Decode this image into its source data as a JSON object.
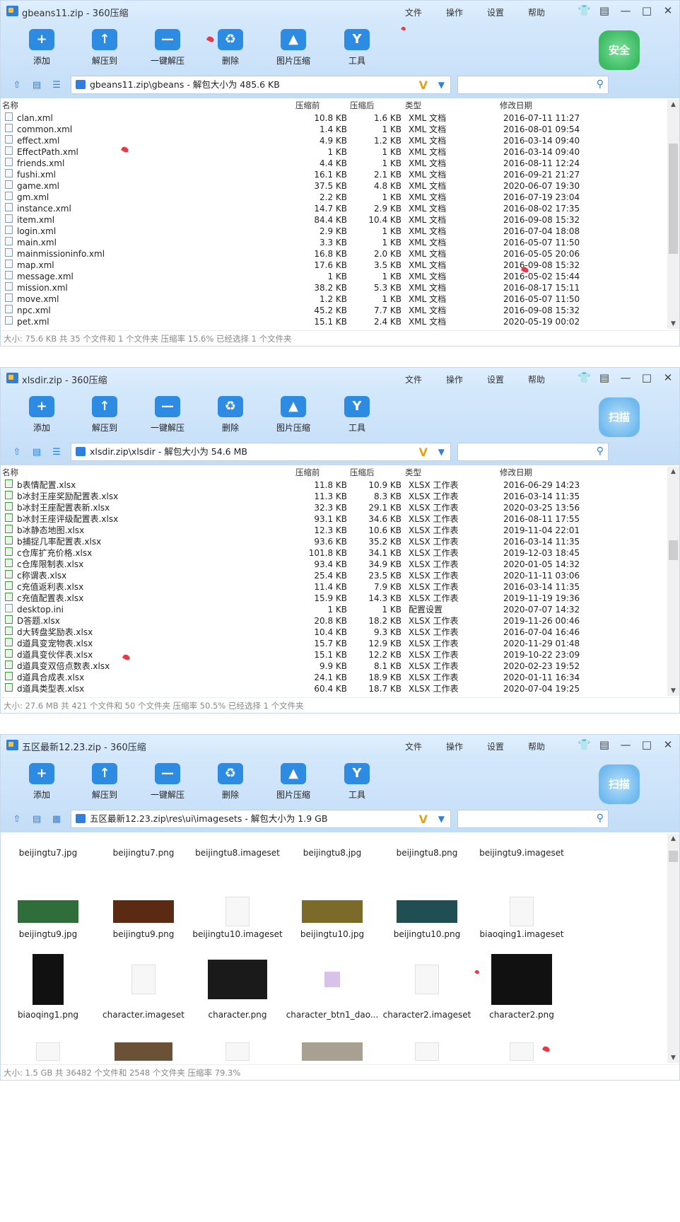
{
  "windows": [
    {
      "title": "gbeans11.zip - 360压缩",
      "menu": [
        "文件",
        "操作",
        "设置",
        "帮助"
      ],
      "tools": [
        "添加",
        "解压到",
        "一键解压",
        "删除",
        "图片压缩",
        "工具"
      ],
      "badge": "安全",
      "path": "gbeans11.zip\\gbeans - 解包大小为 485.6 KB",
      "columns": [
        "名称",
        "压缩前",
        "压缩后",
        "类型",
        "修改日期"
      ],
      "rows": [
        [
          "clan.xml",
          "10.8 KB",
          "1.6 KB",
          "XML 文档",
          "2016-07-11 11:27"
        ],
        [
          "common.xml",
          "1.4 KB",
          "1 KB",
          "XML 文档",
          "2016-08-01 09:54"
        ],
        [
          "effect.xml",
          "4.9 KB",
          "1.2 KB",
          "XML 文档",
          "2016-03-14 09:40"
        ],
        [
          "EffectPath.xml",
          "1 KB",
          "1 KB",
          "XML 文档",
          "2016-03-14 09:40"
        ],
        [
          "friends.xml",
          "4.4 KB",
          "1 KB",
          "XML 文档",
          "2016-08-11 12:24"
        ],
        [
          "fushi.xml",
          "16.1 KB",
          "2.1 KB",
          "XML 文档",
          "2016-09-21 21:27"
        ],
        [
          "game.xml",
          "37.5 KB",
          "4.8 KB",
          "XML 文档",
          "2020-06-07 19:30"
        ],
        [
          "gm.xml",
          "2.2 KB",
          "1 KB",
          "XML 文档",
          "2016-07-19 23:04"
        ],
        [
          "instance.xml",
          "14.7 KB",
          "2.9 KB",
          "XML 文档",
          "2016-08-02 17:35"
        ],
        [
          "item.xml",
          "84.4 KB",
          "10.4 KB",
          "XML 文档",
          "2016-09-08 15:32"
        ],
        [
          "login.xml",
          "2.9 KB",
          "1 KB",
          "XML 文档",
          "2016-07-04 18:08"
        ],
        [
          "main.xml",
          "3.3 KB",
          "1 KB",
          "XML 文档",
          "2016-05-07 11:50"
        ],
        [
          "mainmissioninfo.xml",
          "16.8 KB",
          "2.0 KB",
          "XML 文档",
          "2016-05-05 20:06"
        ],
        [
          "map.xml",
          "17.6 KB",
          "3.5 KB",
          "XML 文档",
          "2016-09-08 15:32"
        ],
        [
          "message.xml",
          "1 KB",
          "1 KB",
          "XML 文档",
          "2016-05-02 15:44"
        ],
        [
          "mission.xml",
          "38.2 KB",
          "5.3 KB",
          "XML 文档",
          "2016-08-17 15:11"
        ],
        [
          "move.xml",
          "1.2 KB",
          "1 KB",
          "XML 文档",
          "2016-05-07 11:50"
        ],
        [
          "npc.xml",
          "45.2 KB",
          "7.7 KB",
          "XML 文档",
          "2016-09-08 15:32"
        ],
        [
          "pet.xml",
          "15.1 KB",
          "2.4 KB",
          "XML 文档",
          "2020-05-19 00:02"
        ]
      ],
      "status": "大小: 75.6 KB 共 35 个文件和 1 个文件夹 压缩率 15.6% 已经选择 1 个文件夹"
    },
    {
      "title": "xlsdir.zip - 360压缩",
      "menu": [
        "文件",
        "操作",
        "设置",
        "帮助"
      ],
      "tools": [
        "添加",
        "解压到",
        "一键解压",
        "删除",
        "图片压缩",
        "工具"
      ],
      "badge": "扫描",
      "path": "xlsdir.zip\\xlsdir - 解包大小为 54.6 MB",
      "columns": [
        "名称",
        "压缩前",
        "压缩后",
        "类型",
        "修改日期"
      ],
      "rows": [
        [
          "b表情配置.xlsx",
          "11.8 KB",
          "10.9 KB",
          "XLSX 工作表",
          "2016-06-29 14:23"
        ],
        [
          "b冰封王座奖励配置表.xlsx",
          "11.3 KB",
          "8.3 KB",
          "XLSX 工作表",
          "2016-03-14 11:35"
        ],
        [
          "b冰封王座配置表新.xlsx",
          "32.3 KB",
          "29.1 KB",
          "XLSX 工作表",
          "2020-03-25 13:56"
        ],
        [
          "b冰封王座评级配置表.xlsx",
          "93.1 KB",
          "34.6 KB",
          "XLSX 工作表",
          "2016-08-11 17:55"
        ],
        [
          "b冰静态地图.xlsx",
          "12.3 KB",
          "10.6 KB",
          "XLSX 工作表",
          "2019-11-04 22:01"
        ],
        [
          "b捕捉几率配置表.xlsx",
          "93.6 KB",
          "35.2 KB",
          "XLSX 工作表",
          "2016-03-14 11:35"
        ],
        [
          "c仓库扩充价格.xlsx",
          "101.8 KB",
          "34.1 KB",
          "XLSX 工作表",
          "2019-12-03 18:45"
        ],
        [
          "c仓库限制表.xlsx",
          "93.4 KB",
          "34.9 KB",
          "XLSX 工作表",
          "2020-01-05 14:32"
        ],
        [
          "c称谓表.xlsx",
          "25.4 KB",
          "23.5 KB",
          "XLSX 工作表",
          "2020-11-11 03:06"
        ],
        [
          "c充值返利表.xlsx",
          "11.4 KB",
          "7.9 KB",
          "XLSX 工作表",
          "2016-03-14 11:35"
        ],
        [
          "c充值配置表.xlsx",
          "15.9 KB",
          "14.3 KB",
          "XLSX 工作表",
          "2019-11-19 19:36"
        ],
        [
          "desktop.ini",
          "1 KB",
          "1 KB",
          "配置设置",
          "2020-07-07 14:32"
        ],
        [
          "D答题.xlsx",
          "20.8 KB",
          "18.2 KB",
          "XLSX 工作表",
          "2019-11-26 00:46"
        ],
        [
          "d大转盘奖励表.xlsx",
          "10.4 KB",
          "9.3 KB",
          "XLSX 工作表",
          "2016-07-04 16:46"
        ],
        [
          "d道具变宠物表.xlsx",
          "15.7 KB",
          "12.9 KB",
          "XLSX 工作表",
          "2020-11-29 01:48"
        ],
        [
          "d道具变伙伴表.xlsx",
          "15.1 KB",
          "12.2 KB",
          "XLSX 工作表",
          "2019-10-22 23:09"
        ],
        [
          "d道具变双倍点数表.xlsx",
          "9.9 KB",
          "8.1 KB",
          "XLSX 工作表",
          "2020-02-23 19:52"
        ],
        [
          "d道具合成表.xlsx",
          "24.1 KB",
          "18.9 KB",
          "XLSX 工作表",
          "2020-01-11 16:34"
        ],
        [
          "d道具类型表.xlsx",
          "60.4 KB",
          "18.7 KB",
          "XLSX 工作表",
          "2020-07-04 19:25"
        ]
      ],
      "status": "大小: 27.6 MB 共 421 个文件和 50 个文件夹 压缩率 50.5% 已经选择 1 个文件夹"
    },
    {
      "title": "五区最新12.23.zip - 360压缩",
      "menu": [
        "文件",
        "操作",
        "设置",
        "帮助"
      ],
      "tools": [
        "添加",
        "解压到",
        "一键解压",
        "删除",
        "图片压缩",
        "工具"
      ],
      "badge": "扫描",
      "path": "五区最新12.23.zip\\res\\ui\\imagesets - 解包大小为 1.9 GB",
      "grid_rows": [
        [
          "beijingtu7.jpg",
          "beijingtu7.png",
          "beijingtu8.imageset",
          "beijingtu8.jpg",
          "beijingtu8.png",
          "beijingtu9.imageset"
        ],
        [
          "beijingtu9.jpg",
          "beijingtu9.png",
          "beijingtu10.imageset",
          "beijingtu10.jpg",
          "beijingtu10.png",
          "biaoqing1.imageset"
        ],
        [
          "biaoqing1.png",
          "character.imageset",
          "character.png",
          "character_btn1_dao...",
          "character2.imageset",
          "character2.png"
        ]
      ],
      "status": "大小: 1.5 GB 共 36482 个文件和 2548 个文件夹 压缩率 79.3%"
    }
  ],
  "icons": {
    "add": "plus-folder-icon",
    "extract": "extract-folder-icon",
    "quick": "quick-extract-icon",
    "delete": "recycle-bin-icon",
    "imgcomp": "image-compress-icon",
    "tools": "toolbox-icon"
  }
}
